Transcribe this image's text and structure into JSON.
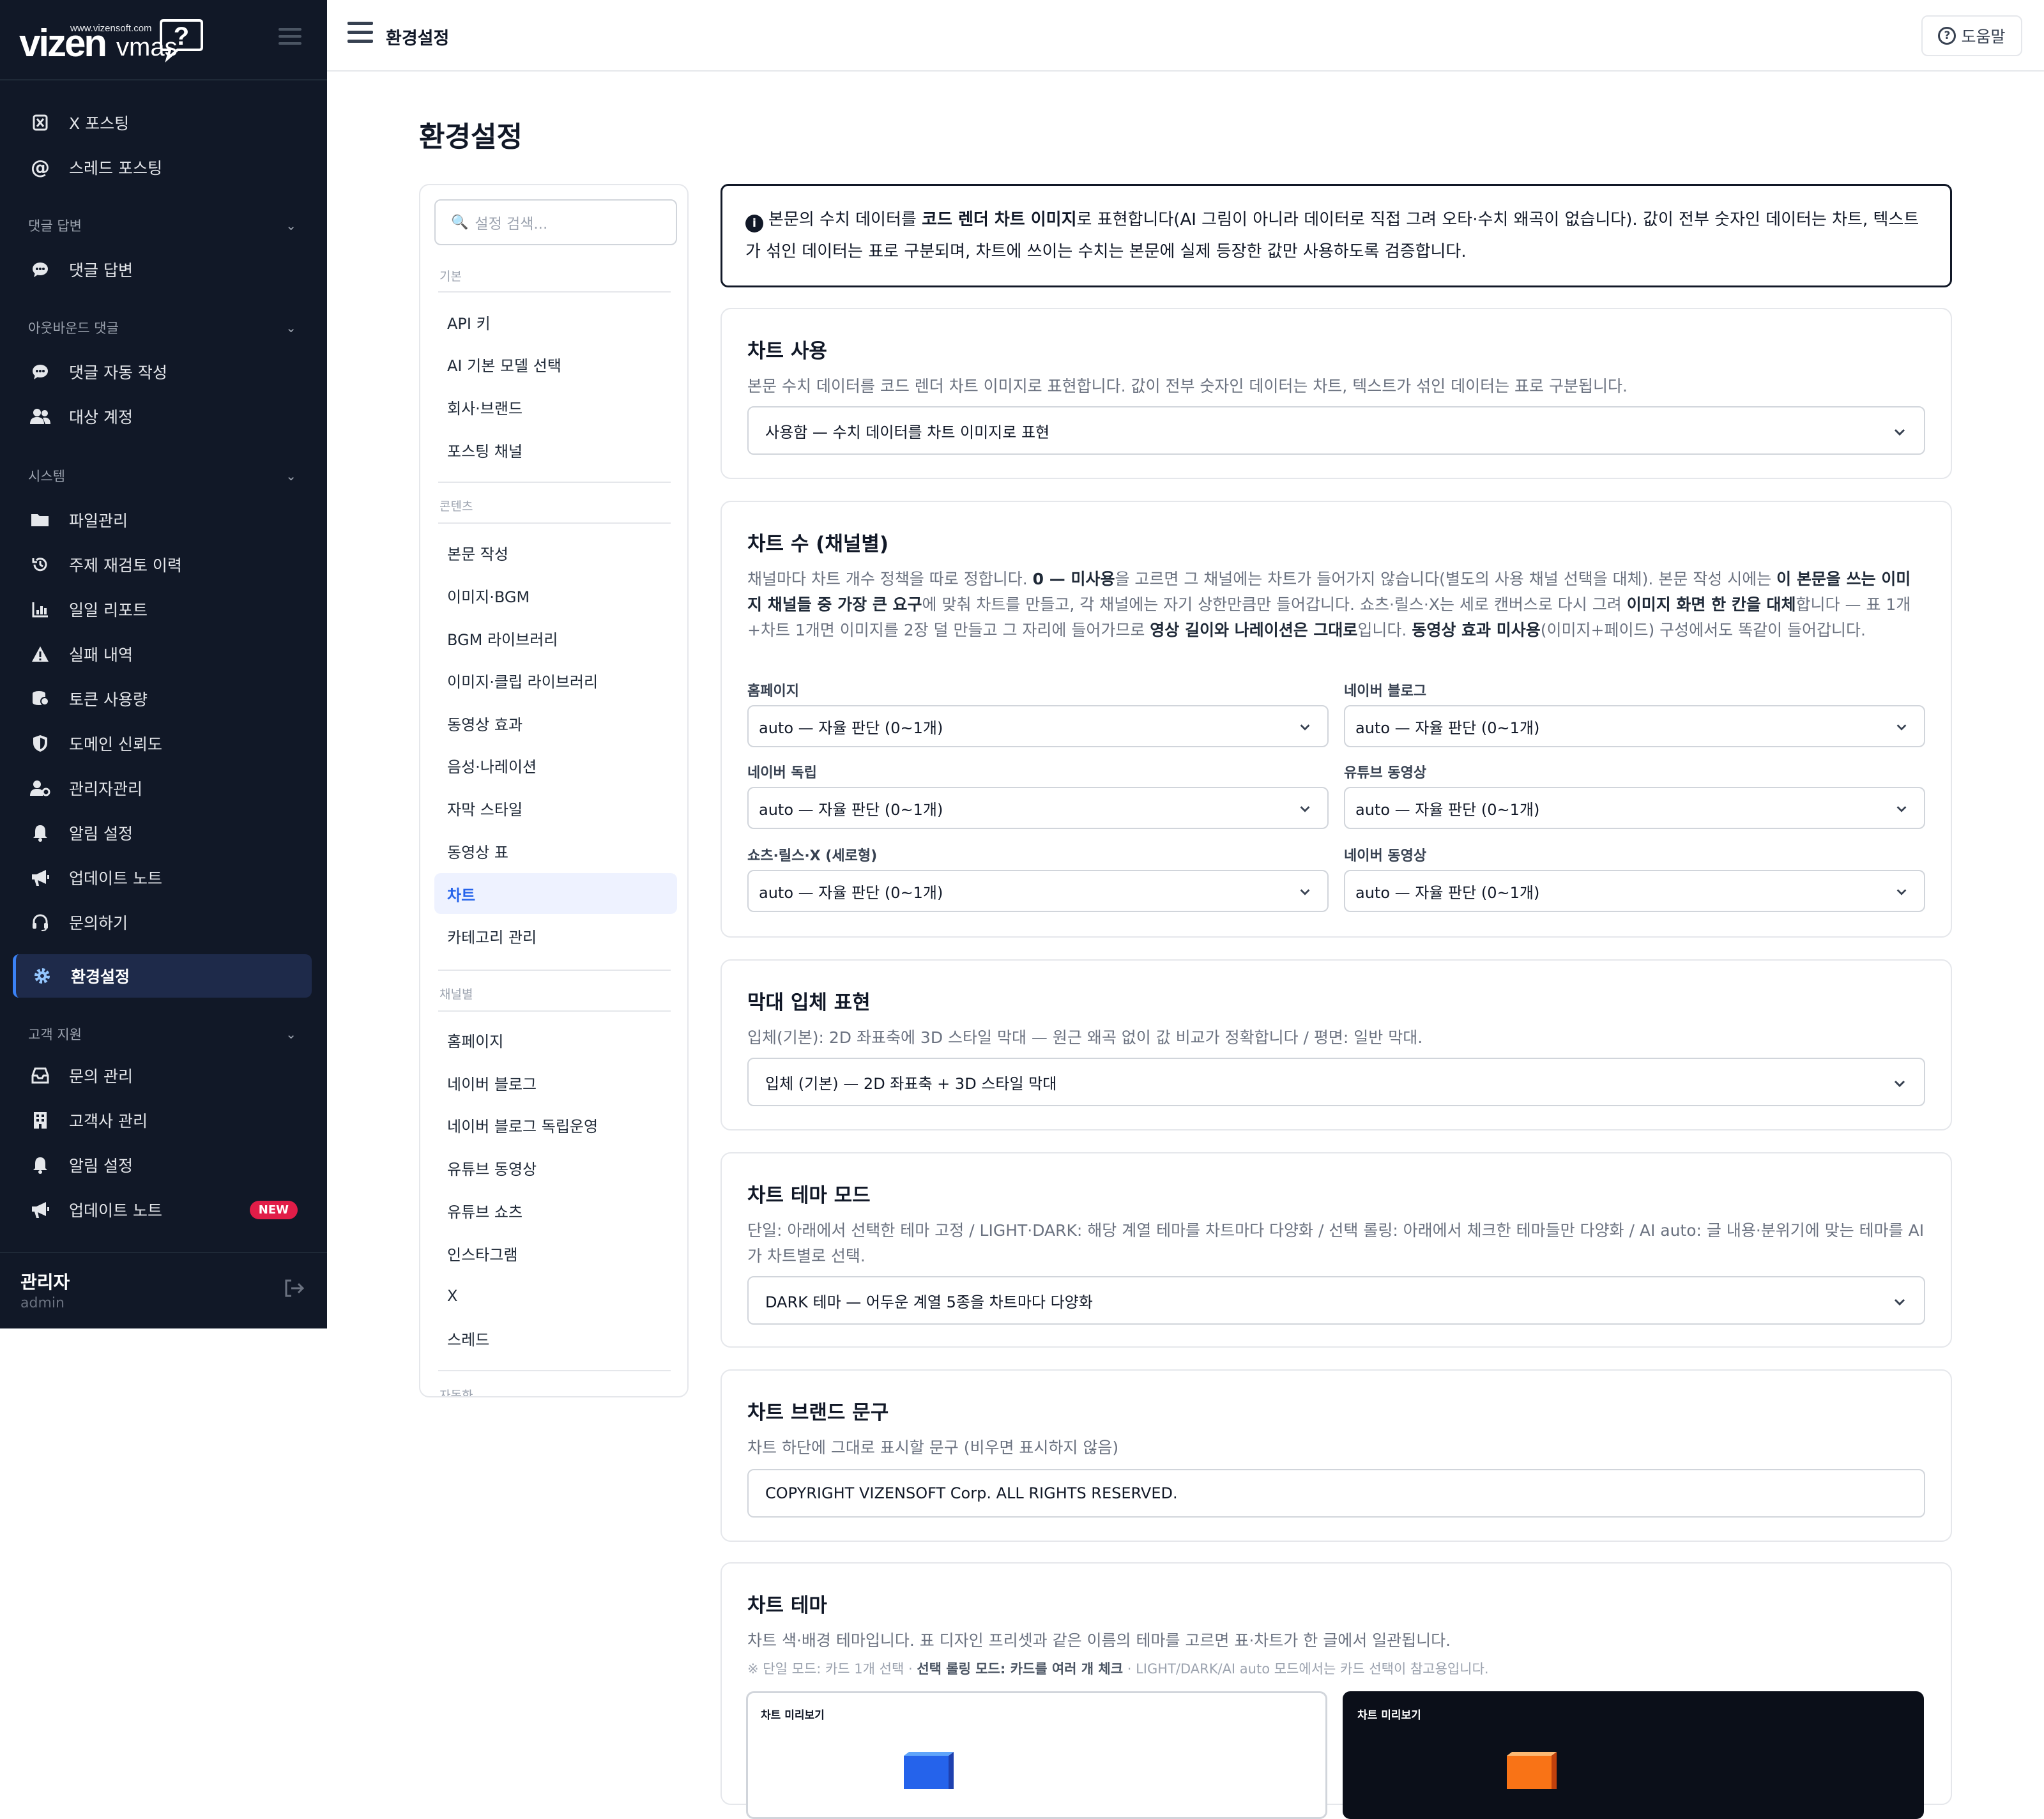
{
  "logo": {
    "site": "www.vizensoft.com",
    "brand_main": "vizen",
    "brand_sub": "vmas"
  },
  "sidebar": {
    "items_top": [
      {
        "label": "X 포스팅",
        "icon": "x-icon"
      },
      {
        "label": "스레드 포스팅",
        "icon": "at-icon"
      }
    ],
    "section_comments": "댓글 답변",
    "comments_items": [
      {
        "label": "댓글 답변",
        "icon": "comment-icon"
      }
    ],
    "section_outbound": "아웃바운드 댓글",
    "outbound_items": [
      {
        "label": "댓글 자동 작성",
        "icon": "comment-icon"
      },
      {
        "label": "대상 계정",
        "icon": "users-icon"
      }
    ],
    "section_system": "시스템",
    "system_items": [
      {
        "label": "파일관리",
        "icon": "folder-icon"
      },
      {
        "label": "주제 재검토 이력",
        "icon": "history-icon"
      },
      {
        "label": "일일 리포트",
        "icon": "chart-icon"
      },
      {
        "label": "실패 내역",
        "icon": "warning-icon"
      },
      {
        "label": "토큰 사용량",
        "icon": "coins-icon"
      },
      {
        "label": "도메인 신뢰도",
        "icon": "shield-icon"
      },
      {
        "label": "관리자관리",
        "icon": "user-gear-icon"
      },
      {
        "label": "알림 설정",
        "icon": "bell-icon"
      },
      {
        "label": "업데이트 노트",
        "icon": "megaphone-icon"
      },
      {
        "label": "문의하기",
        "icon": "headset-icon"
      },
      {
        "label": "환경설정",
        "icon": "gear-icon"
      }
    ],
    "section_support": "고객 지원",
    "support_items": [
      {
        "label": "문의 관리",
        "icon": "inbox-icon"
      },
      {
        "label": "고객사 관리",
        "icon": "building-icon"
      },
      {
        "label": "알림 설정",
        "icon": "bell-icon"
      },
      {
        "label": "업데이트 노트",
        "icon": "megaphone-icon",
        "badge": "NEW"
      }
    ],
    "user": {
      "name": "관리자",
      "id": "admin"
    }
  },
  "topbar": {
    "title": "환경설정",
    "help": "도움말"
  },
  "page": {
    "title": "환경설정"
  },
  "subnav": {
    "search_placeholder": "설정 검색...",
    "group_basic": "기본",
    "basic": [
      "API 키",
      "AI 기본 모델 선택",
      "회사·브랜드",
      "포스팅 채널"
    ],
    "group_content": "콘텐츠",
    "content": [
      "본문 작성",
      "이미지·BGM",
      "BGM 라이브러리",
      "이미지·클립 라이브러리",
      "동영상 효과",
      "음성·나레이션",
      "자막 스타일",
      "동영상 표",
      "차트",
      "카테고리 관리"
    ],
    "group_channel": "채널별",
    "channel": [
      "홈페이지",
      "네이버 블로그",
      "네이버 블로그 독립운영",
      "유튜브 동영상",
      "유튜브 쇼츠",
      "인스타그램",
      "X",
      "스레드"
    ],
    "group_auto": "자동화"
  },
  "notice": {
    "p1": "본문의 수치 데이터를 ",
    "b1": "코드 렌더 차트 이미지",
    "p2": "로 표현합니다(AI 그림이 아니라 데이터로 직접 그려 오타·수치 왜곡이 없습니다). 값이 전부 숫자인 데이터는 차트, 텍스트가 섞인 데이터는 표로 구분되며, 차트에 쓰이는 수치는 본문에 실제 등장한 값만 사용하도록 검증합니다."
  },
  "chart_use": {
    "title": "차트 사용",
    "desc": "본문 수치 데이터를 코드 렌더 차트 이미지로 표현합니다. 값이 전부 숫자인 데이터는 차트, 텍스트가 섞인 데이터는 표로 구분됩니다.",
    "value": "사용함 — 수치 데이터를 차트 이미지로 표현"
  },
  "chart_count": {
    "title": "차트 수 (채널별)",
    "d1": "채널마다 차트 개수 정책을 따로 정합니다. ",
    "b1": "0 — 미사용",
    "d2": "을 고르면 그 채널에는 차트가 들어가지 않습니다(별도의 사용 채널 선택을 대체). 본문 작성 시에는 ",
    "b2": "이 본문을 쓰는 이미지 채널들 중 가장 큰 요구",
    "d3": "에 맞춰 차트를 만들고, 각 채널에는 자기 상한만큼만 들어갑니다. 쇼츠·릴스·X는 세로 캔버스로 다시 그려 ",
    "b3": "이미지 화면 한 칸을 대체",
    "d4": "합니다 — 표 1개+차트 1개면 이미지를 2장 덜 만들고 그 자리에 들어가므로 ",
    "b4": "영상 길이와 나레이션은 그대로",
    "d5": "입니다. ",
    "b5": "동영상 효과 미사용",
    "d6": "(이미지+페이드) 구성에서도 똑같이 들어갑니다.",
    "fields": [
      {
        "label": "홈페이지",
        "value": "auto — 자율 판단 (0~1개)"
      },
      {
        "label": "네이버 블로그",
        "value": "auto — 자율 판단 (0~1개)"
      },
      {
        "label": "네이버 독립",
        "value": "auto — 자율 판단 (0~1개)"
      },
      {
        "label": "유튜브 동영상",
        "value": "auto — 자율 판단 (0~1개)"
      },
      {
        "label": "쇼츠·릴스·X (세로형)",
        "value": "auto — 자율 판단 (0~1개)"
      },
      {
        "label": "네이버 동영상",
        "value": "auto — 자율 판단 (0~1개)"
      }
    ]
  },
  "bar_3d": {
    "title": "막대 입체 표현",
    "desc": "입체(기본): 2D 좌표축에 3D 스타일 막대 — 원근 왜곡 없이 값 비교가 정확합니다 / 평면: 일반 막대.",
    "value": "입체 (기본) — 2D 좌표축 + 3D 스타일 막대"
  },
  "theme_mode": {
    "title": "차트 테마 모드",
    "desc": "단일: 아래에서 선택한 테마 고정 / LIGHT·DARK: 해당 계열 테마를 차트마다 다양화 / 선택 롤링: 아래에서 체크한 테마들만 다양화 / AI auto: 글 내용·분위기에 맞는 테마를 AI가 차트별로 선택.",
    "value": "DARK 테마 — 어두운 계열 5종을 차트마다 다양화"
  },
  "brand_text": {
    "title": "차트 브랜드 문구",
    "desc": "차트 하단에 그대로 표시할 문구 (비우면 표시하지 않음)",
    "value": "COPYRIGHT VIZENSOFT Corp. ALL RIGHTS RESERVED."
  },
  "chart_theme": {
    "title": "차트 테마",
    "desc": "차트 색·배경 테마입니다. 표 디자인 프리셋과 같은 이름의 테마를 고르면 표·차트가 한 글에서 일관됩니다.",
    "n1": "※ 단일 모드: 카드 1개 선택 · ",
    "nb": "선택 롤링 모드: 카드를 여러 개 체크",
    "n2": " · LIGHT/DARK/AI auto 모드에서는 카드 선택이 참고용입니다.",
    "preview_label": "차트 미리보기",
    "colors": {
      "light_bar": "#2563eb",
      "dark_bar": "#f97316",
      "dark_bg": "#0b0f19"
    }
  },
  "colors": {
    "sidebar_bg": "#111827",
    "accent": "#2563eb",
    "new_badge": "#e11d48"
  }
}
